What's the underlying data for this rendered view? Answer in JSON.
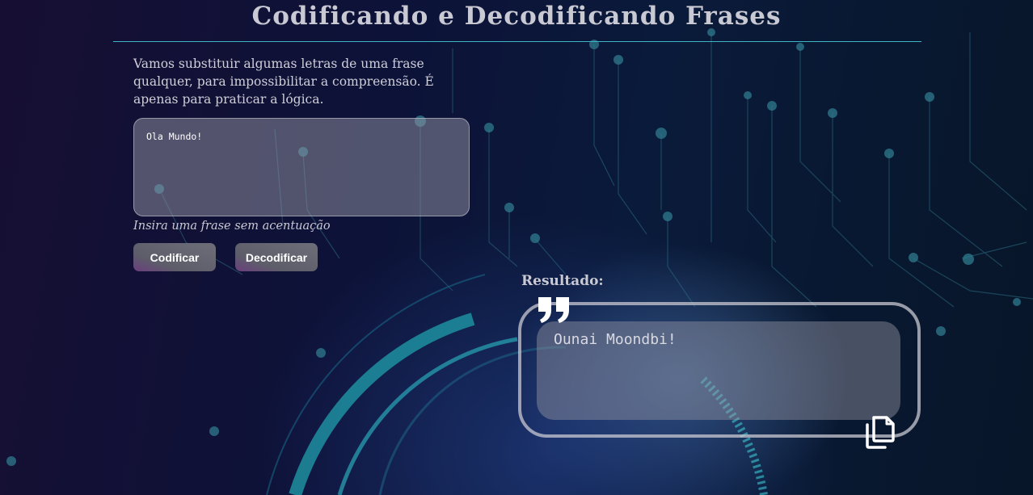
{
  "page": {
    "title": "Codificando e Decodificando Frases"
  },
  "form": {
    "description": "Vamos substituir algumas letras de uma frase qualquer, para impossibilitar a compreensão. É apenas para praticar a lógica.",
    "input_value": "Ola Mundo!",
    "hint": "Insira uma frase sem acentuação",
    "encode_label": "Codificar",
    "decode_label": "Decodificar"
  },
  "result": {
    "label": "Resultado:",
    "text": "Ounai Moondbi!",
    "quote_icon": "quote-icon",
    "copy_icon": "copy-icon"
  },
  "colors": {
    "accent": "#3fb4c4",
    "text": "#c9c9d4",
    "panel": "#8f8f9f"
  }
}
